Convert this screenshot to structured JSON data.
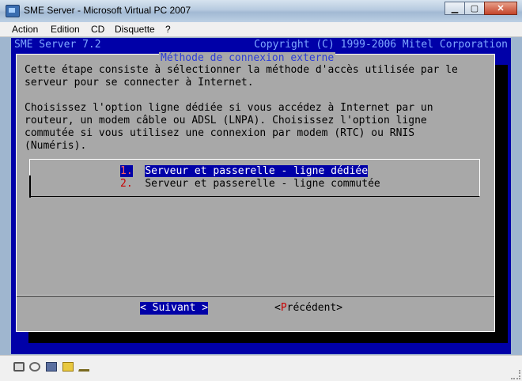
{
  "window": {
    "title": "SME Server - Microsoft Virtual PC 2007"
  },
  "menu": [
    "Action",
    "Edition",
    "CD",
    "Disquette",
    "?"
  ],
  "terminal": {
    "header_left": "SME Server 7.2",
    "header_right": "Copyright (C) 1999-2006 Mitel Corporation",
    "dialog_title": "Méthode de connexion externe",
    "body_lines": [
      "Cette étape consiste à sélectionner la méthode d'accès utilisée par le",
      "serveur pour se connecter à Internet.",
      "",
      "Choisissez l'option ligne dédiée si vous accédez à Internet par un",
      "routeur, un modem câble ou ADSL (LNPA). Choisissez l'option ligne",
      "commutée si vous utilisez une connexion par modem (RTC) ou RNIS",
      "(Numéris)."
    ],
    "options": [
      {
        "num": "1.",
        "label": "Serveur et passerelle - ligne dédiée",
        "selected": true
      },
      {
        "num": "2.",
        "label": "Serveur et passerelle - ligne commutée",
        "selected": false
      }
    ],
    "buttons": {
      "next": {
        "left": "<",
        "hot": " ",
        "text": "Suivant",
        "right": " >"
      },
      "prev": {
        "left": "<",
        "hot": "P",
        "text": "récédent",
        "right": ">"
      }
    }
  },
  "status_icons": [
    "network-icon",
    "cd-icon",
    "floppy-icon",
    "folder-icon",
    "usb-icon"
  ],
  "window_buttons": {
    "minimize": "▁",
    "maximize": "▢",
    "close": "✕"
  }
}
